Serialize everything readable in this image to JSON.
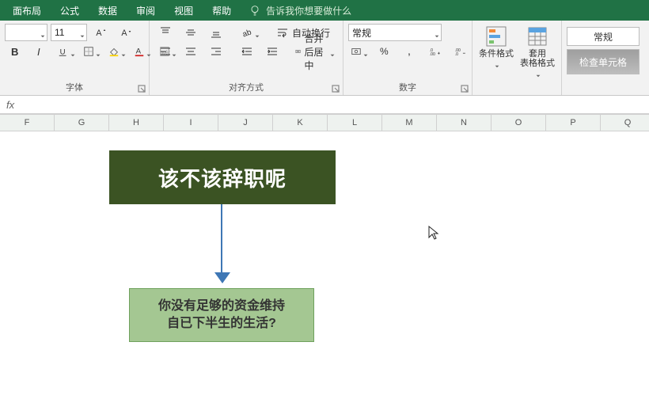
{
  "menu": {
    "items": [
      "面布局",
      "公式",
      "数据",
      "审阅",
      "视图",
      "帮助"
    ],
    "tellme": "告诉我你想要做什么"
  },
  "ribbon": {
    "font": {
      "name": "",
      "size": "11",
      "group_label": "字体"
    },
    "align": {
      "wrap_label": "自动换行",
      "merge_label": "合并后居中",
      "group_label": "对齐方式"
    },
    "number": {
      "format": "常规",
      "group_label": "数字"
    },
    "styles": {
      "cond_label": "条件格式",
      "table_label": "套用\n表格格式",
      "default_style_label": "常规",
      "check_cell_label": "检查单元格"
    }
  },
  "formula_bar": {
    "fx": "fx",
    "value": ""
  },
  "columns": [
    "F",
    "G",
    "H",
    "I",
    "J",
    "K",
    "L",
    "M",
    "N",
    "O",
    "P",
    "Q"
  ],
  "diagram": {
    "title": "该不该辞职呢",
    "question": "你没有足够的资金维持\n自已下半生的生活?"
  }
}
